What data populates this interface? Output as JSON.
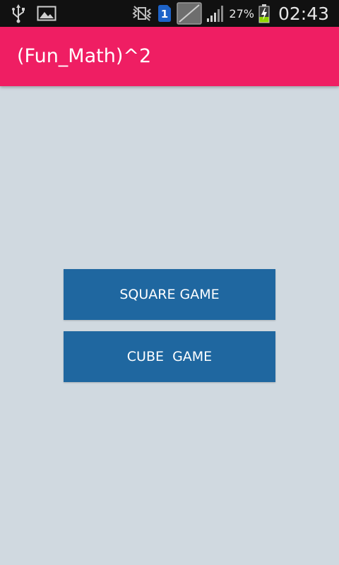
{
  "status_bar": {
    "battery_percent": "27%",
    "clock": "02:43",
    "sim_badge": "1",
    "icons": [
      "usb-icon",
      "image-icon",
      "no-vibrate-icon",
      "sim-icon",
      "no-data-icon",
      "signal-icon",
      "battery-charging-icon"
    ]
  },
  "app_bar": {
    "title": "(Fun_Math)^2",
    "color": "#ef1e63"
  },
  "buttons": {
    "square_game": "SQUARE GAME",
    "cube_game": "CUBE  GAME",
    "color": "#1f67a0"
  },
  "background_color": "#d0d9e0"
}
